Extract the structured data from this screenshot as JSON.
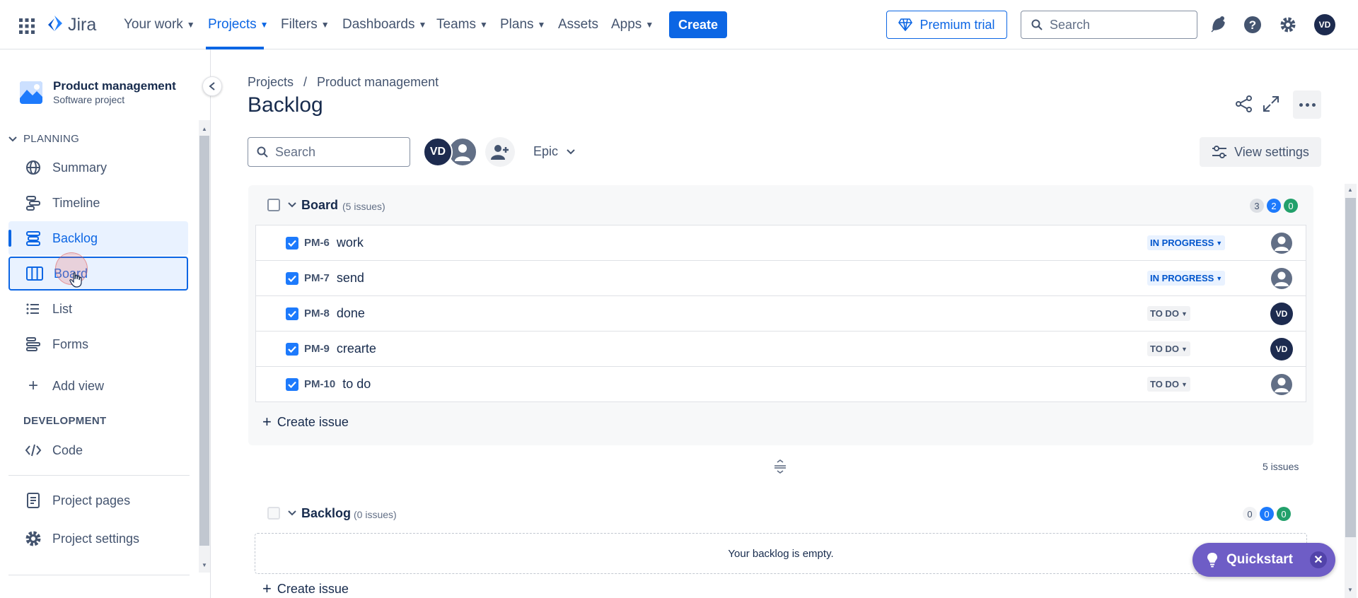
{
  "topnav": {
    "logo_text": "Jira",
    "items": [
      {
        "label": "Your work",
        "dropdown": true
      },
      {
        "label": "Projects",
        "dropdown": true,
        "active": true
      },
      {
        "label": "Filters",
        "dropdown": true
      },
      {
        "label": "Dashboards",
        "dropdown": true
      },
      {
        "label": "Teams",
        "dropdown": true
      },
      {
        "label": "Plans",
        "dropdown": true
      },
      {
        "label": "Assets",
        "dropdown": false
      },
      {
        "label": "Apps",
        "dropdown": true
      }
    ],
    "create_label": "Create",
    "premium_label": "Premium trial",
    "search_placeholder": "Search",
    "user_initials": "VD"
  },
  "sidebar": {
    "project_name": "Product management",
    "project_type": "Software project",
    "planning_label": "PLANNING",
    "planning_items": [
      {
        "label": "Summary",
        "icon": "globe-icon"
      },
      {
        "label": "Timeline",
        "icon": "timeline-icon"
      },
      {
        "label": "Backlog",
        "icon": "backlog-icon",
        "selected": true
      },
      {
        "label": "Board",
        "icon": "board-icon",
        "focused": true
      },
      {
        "label": "List",
        "icon": "list-icon"
      },
      {
        "label": "Forms",
        "icon": "forms-icon"
      }
    ],
    "add_view_label": "Add view",
    "development_label": "DEVELOPMENT",
    "code_label": "Code",
    "project_pages_label": "Project pages",
    "project_settings_label": "Project settings"
  },
  "main": {
    "breadcrumb_projects": "Projects",
    "breadcrumb_separator": "/",
    "breadcrumb_project": "Product management",
    "title": "Backlog",
    "search_placeholder": "Search",
    "avatar_initials": "VD",
    "epic_label": "Epic",
    "view_settings_label": "View settings",
    "board_group": {
      "name": "Board",
      "issue_count": "(5 issues)",
      "counts": {
        "todo": "3",
        "in_progress": "2",
        "done": "0"
      },
      "issues": [
        {
          "key": "PM-6",
          "summary": "work",
          "status": "IN PROGRESS",
          "status_type": "ip",
          "assignee": "unassigned"
        },
        {
          "key": "PM-7",
          "summary": "send",
          "status": "IN PROGRESS",
          "status_type": "ip",
          "assignee": "unassigned"
        },
        {
          "key": "PM-8",
          "summary": "done",
          "status": "TO DO",
          "status_type": "todo",
          "assignee": "VD"
        },
        {
          "key": "PM-9",
          "summary": "crearte",
          "status": "TO DO",
          "status_type": "todo",
          "assignee": "VD"
        },
        {
          "key": "PM-10",
          "summary": "to do",
          "status": "TO DO",
          "status_type": "todo",
          "assignee": "unassigned"
        }
      ],
      "create_issue_label": "Create issue"
    },
    "total_issues_label": "5 issues",
    "backlog_group": {
      "name": "Backlog",
      "issue_count": "(0 issues)",
      "counts": {
        "todo": "0",
        "in_progress": "0",
        "done": "0"
      },
      "empty_message": "Your backlog is empty.",
      "create_issue_label": "Create issue"
    },
    "quickstart_label": "Quickstart"
  },
  "colors": {
    "brand_blue": "#0c66e4",
    "selected_bg": "#e9f2ff",
    "done_green": "#22a06b",
    "quickstart_purple": "#6e5dc6"
  }
}
